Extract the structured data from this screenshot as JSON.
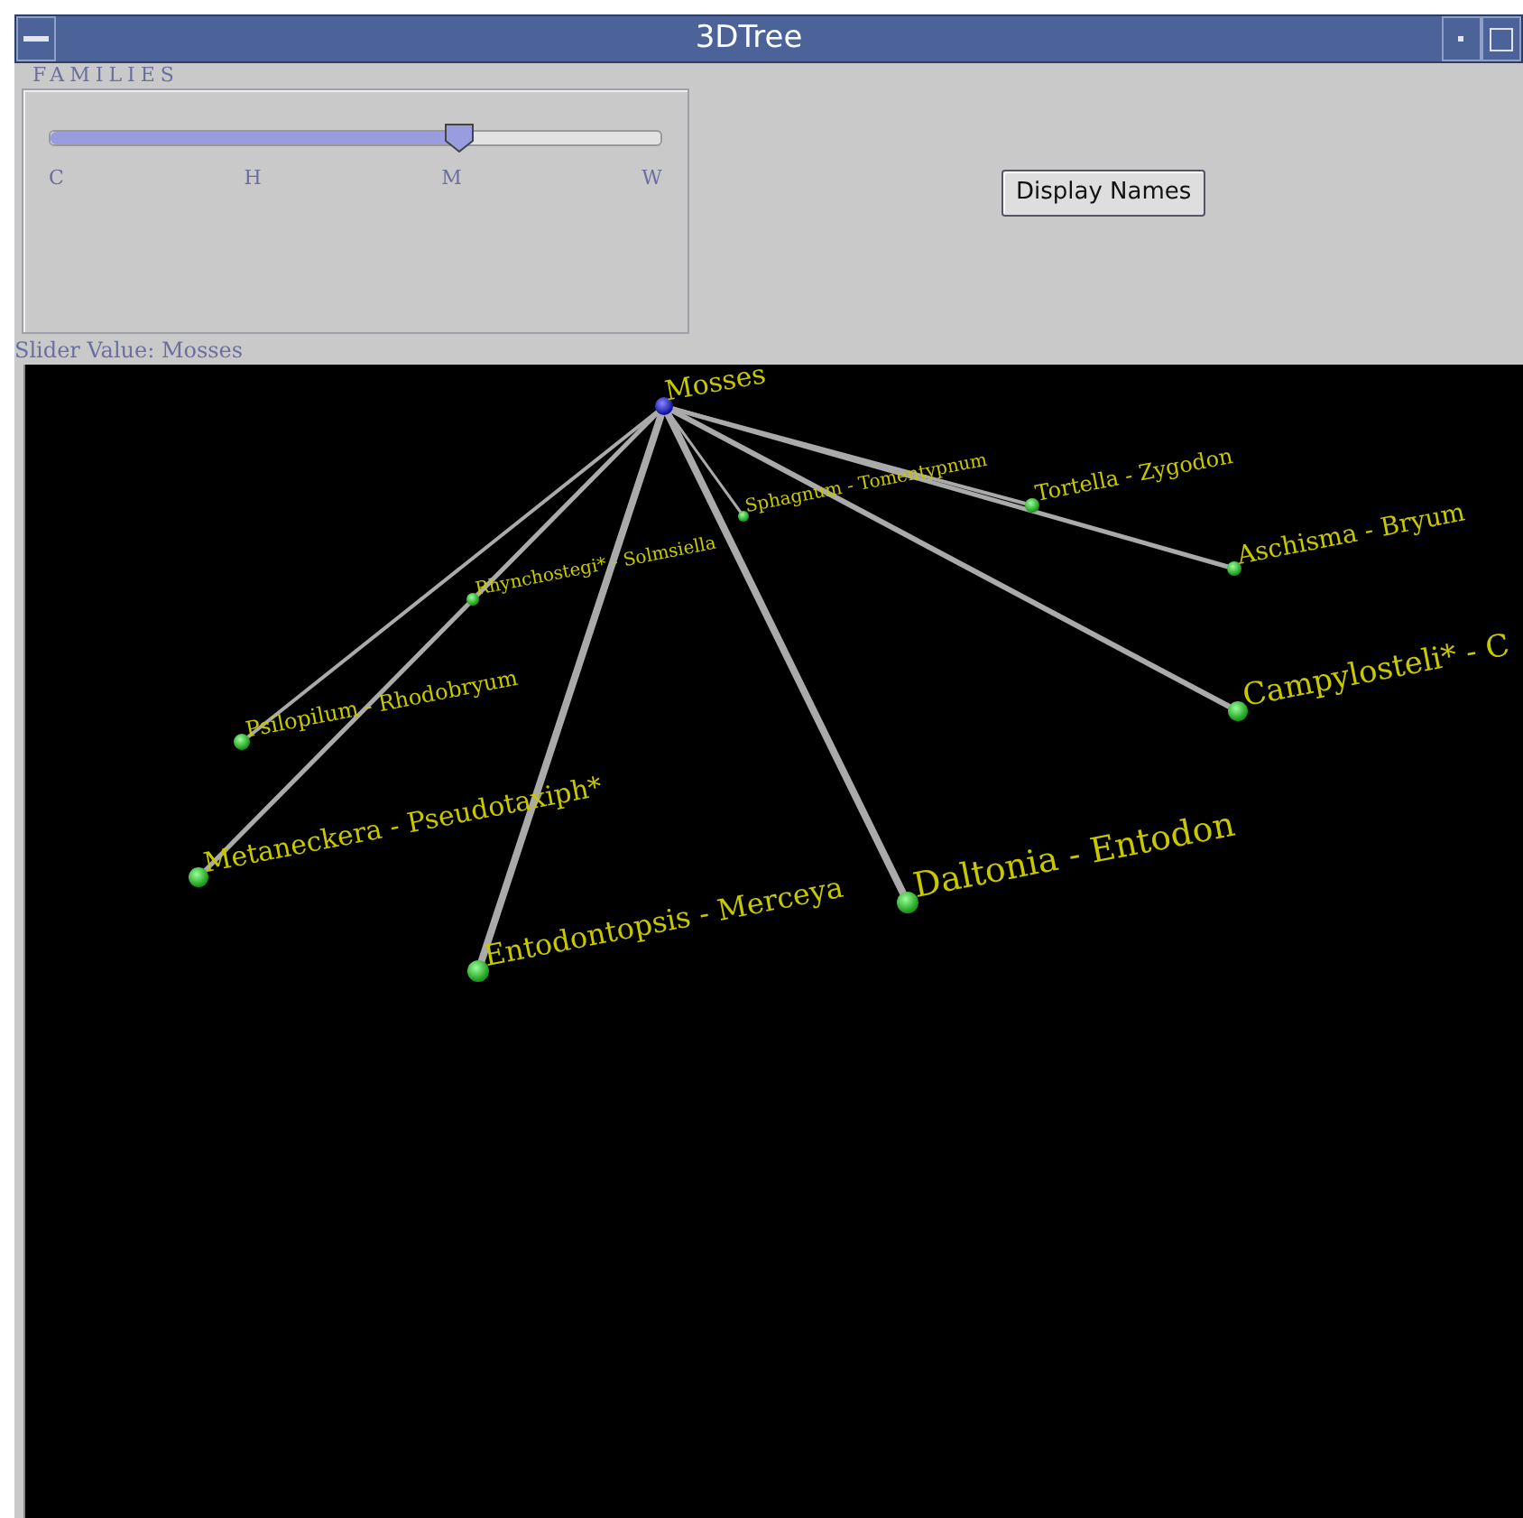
{
  "window": {
    "title": "3DTree"
  },
  "families": {
    "label": "FAMILIES",
    "level": 0.67,
    "ticks": [
      "C",
      "H",
      "M",
      "W"
    ],
    "value_text": "Slider Value: Mosses"
  },
  "display_button": "Display Names",
  "tree": {
    "root": {
      "label": "Mosses"
    },
    "children": [
      {
        "label": "Aschisma - Bryum"
      },
      {
        "label": "Campylosteli* - C"
      },
      {
        "label": "Daltonia - Entodon"
      },
      {
        "label": "Entodontopsis - Merceya"
      },
      {
        "label": "Metaneckera - Pseudotaxiph*"
      },
      {
        "label": "Psilopilum - Rhodobryum"
      },
      {
        "label": "Rhynchostegi* - Solmsiella"
      },
      {
        "label": "Sphagnum - Tomentypnum"
      },
      {
        "label": "Tortella - Zygodon"
      }
    ]
  }
}
